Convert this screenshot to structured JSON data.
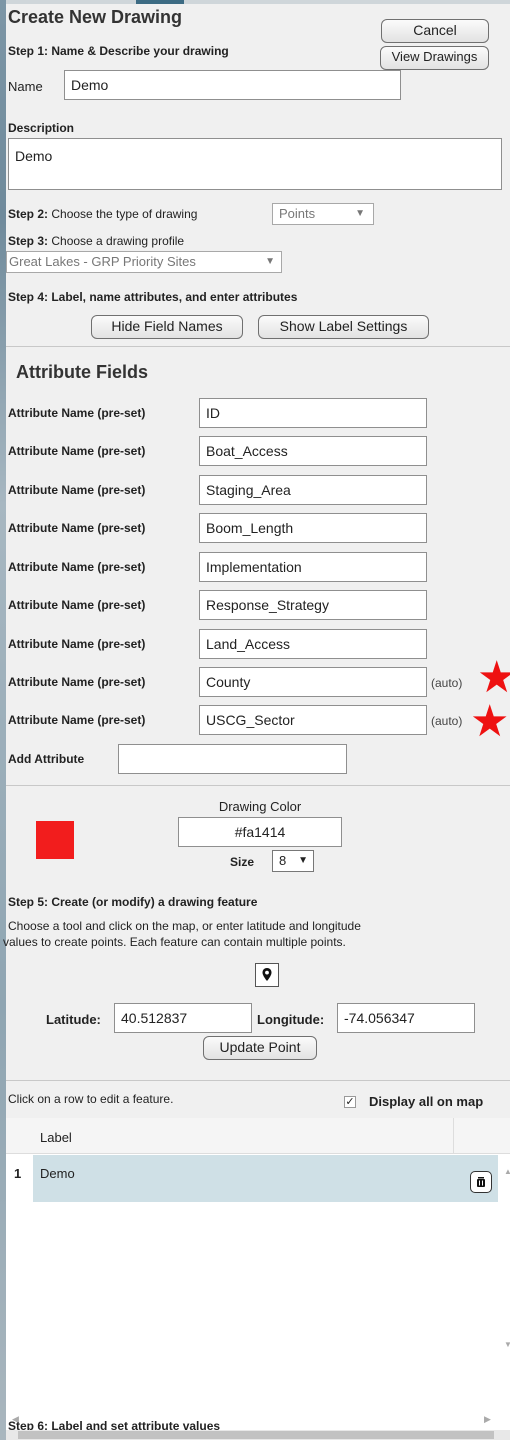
{
  "header": {
    "title": "Create New Drawing",
    "cancel_label": "Cancel",
    "view_drawings_label": "View Drawings"
  },
  "step1": {
    "label": "Step 1: Name & Describe your drawing",
    "name_label": "Name",
    "name_value": "Demo",
    "description_label": "Description",
    "description_value": "Demo"
  },
  "step2": {
    "label": "Step 2: Choose the type of drawing",
    "type_value": "Points"
  },
  "step3": {
    "label": "Step 3: Choose a drawing profile",
    "profile_value": "Great Lakes - GRP Priority Sites"
  },
  "step4": {
    "label": "Step 4: Label, name attributes, and enter attributes",
    "hide_field_names_label": "Hide Field Names",
    "show_label_settings_label": "Show Label Settings"
  },
  "attributes": {
    "heading": "Attribute Fields",
    "row_label": "Attribute Name (pre-set)",
    "fields": [
      {
        "value": "ID",
        "auto": ""
      },
      {
        "value": "Boat_Access",
        "auto": ""
      },
      {
        "value": "Staging_Area",
        "auto": ""
      },
      {
        "value": "Boom_Length",
        "auto": ""
      },
      {
        "value": "Implementation",
        "auto": ""
      },
      {
        "value": "Response_Strategy",
        "auto": ""
      },
      {
        "value": "Land_Access",
        "auto": ""
      },
      {
        "value": "County",
        "auto": "(auto)"
      },
      {
        "value": "USCG_Sector",
        "auto": "(auto)"
      }
    ],
    "add_label": "Add Attribute",
    "add_value": ""
  },
  "style": {
    "drawing_color_label": "Drawing Color",
    "color_value": "#fa1414",
    "swatch_color": "#f21d1d",
    "size_label": "Size",
    "size_value": "8"
  },
  "step5": {
    "label": "Step 5: Create (or modify) a drawing feature",
    "help_line1": "Choose a tool and click on the map, or enter latitude and longitude",
    "help_line2": "values to create points. Each feature can contain multiple points.",
    "latitude_label": "Latitude:",
    "latitude_value": "40.512837",
    "longitude_label": "Longitude:",
    "longitude_value": "-74.056347",
    "update_point_label": "Update Point"
  },
  "features": {
    "hint": "Click on a row to edit a feature.",
    "display_all_label": "Display all on map",
    "display_all_checked": true,
    "column_label": "Label",
    "rows": [
      {
        "index": "1",
        "label": "Demo"
      }
    ]
  },
  "step6": {
    "label": "Step 6: Label and set attribute values"
  },
  "icons": [
    "marker-icon",
    "trash-icon",
    "chevron-down-icon",
    "star-icon"
  ]
}
